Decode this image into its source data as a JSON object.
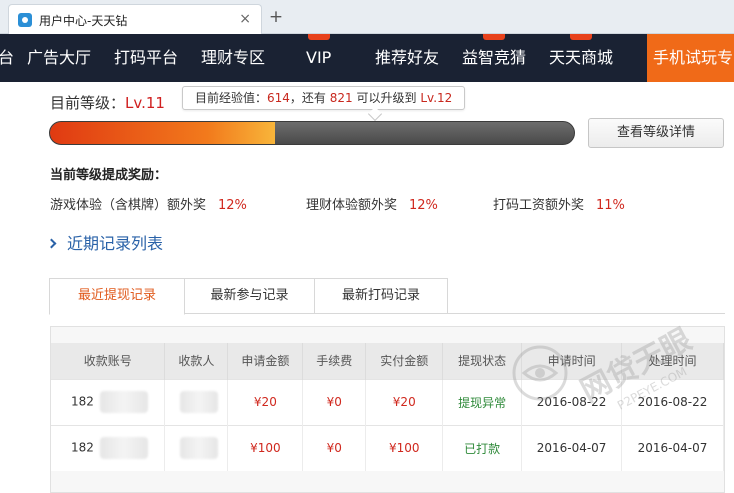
{
  "browser": {
    "tab_title": "用户中心-天天钻",
    "close_glyph": "×",
    "newtab_glyph": "+"
  },
  "nav": {
    "items": [
      {
        "label": "台"
      },
      {
        "label": "广告大厅"
      },
      {
        "label": "打码平台"
      },
      {
        "label": "理财专区"
      },
      {
        "label": "VIP"
      },
      {
        "label": "推荐好友"
      },
      {
        "label": "益智竞猜"
      },
      {
        "label": "天天商城"
      },
      {
        "label": "手机试玩专"
      }
    ]
  },
  "level": {
    "label": "目前等级：",
    "value": "Lv.11",
    "tooltip_prefix": "目前经验值：",
    "exp": "614",
    "tooltip_mid": "，还有",
    "remaining": "821",
    "tooltip_mid2": "可以升级到",
    "next_level": "Lv.12",
    "progress_fraction": 0.43,
    "detail_button": "查看等级详情"
  },
  "bonus": {
    "heading": "当前等级提成奖励：",
    "items": [
      {
        "label": "游戏体验（含棋牌）额外奖",
        "value": "12%"
      },
      {
        "label": "理财体验额外奖",
        "value": "12%"
      },
      {
        "label": "打码工资额外奖",
        "value": "11%"
      }
    ]
  },
  "records_link": "近期记录列表",
  "subtabs": [
    "最近提现记录",
    "最新参与记录",
    "最新打码记录"
  ],
  "table": {
    "headers": [
      "收款账号",
      "收款人",
      "申请金额",
      "手续费",
      "实付金额",
      "提现状态",
      "申请时间",
      "处理时间"
    ],
    "rows": [
      {
        "account": "182",
        "amount": "¥20",
        "fee": "¥0",
        "paid": "¥20",
        "status": "提现异常",
        "applied": "2016-08-22",
        "processed": "2016-08-22"
      },
      {
        "account": "182",
        "amount": "¥100",
        "fee": "¥0",
        "paid": "¥100",
        "status": "已打款",
        "applied": "2016-04-07",
        "processed": "2016-04-07"
      }
    ]
  },
  "watermark": {
    "text": "网贷天眼",
    "url": "P2PEYE.COM"
  },
  "colors": {
    "nav_bg": "#1a2233",
    "nav_active": "#f06a18",
    "accent_red": "#d0281e",
    "link_blue": "#2a62a8",
    "status_green": "#2f8a3a"
  }
}
